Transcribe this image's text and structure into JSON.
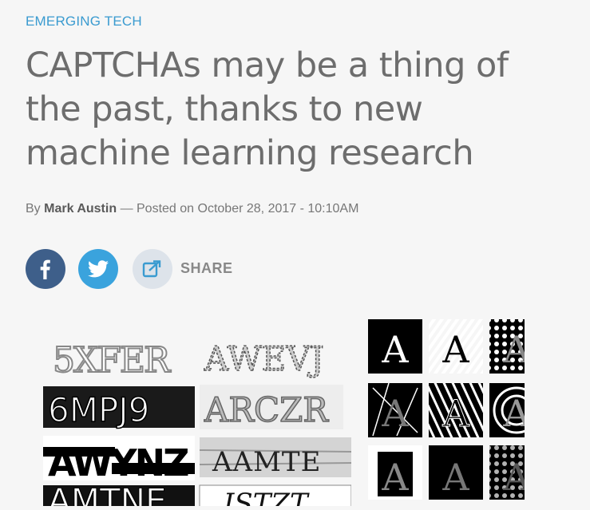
{
  "category": "EMERGING TECH",
  "headline": "CAPTCHAs may be a thing of the past, thanks to new machine learning research",
  "byline": {
    "prefix": "By",
    "author": "Mark Austin",
    "separator": "— Posted on",
    "date": "October 28, 2017 - 10:10AM"
  },
  "share": {
    "label": "SHARE",
    "facebook_icon": "facebook-icon",
    "twitter_icon": "twitter-icon",
    "share_icon": "share-icon"
  },
  "captcha_texts": [
    "5XFER",
    "AWEVJ",
    "6MPJ9",
    "ARCZR",
    "AWYNZ",
    "AAMTE",
    "AMTNE",
    "ISTZT"
  ],
  "letter_tiles": [
    "A",
    "A",
    "A",
    "A",
    "A",
    "A",
    "A",
    "A",
    "A"
  ],
  "colors": {
    "category": "#3a9bd0",
    "facebook": "#3e5f8a",
    "twitter": "#3aa3dd",
    "share": "#dde3ea"
  }
}
